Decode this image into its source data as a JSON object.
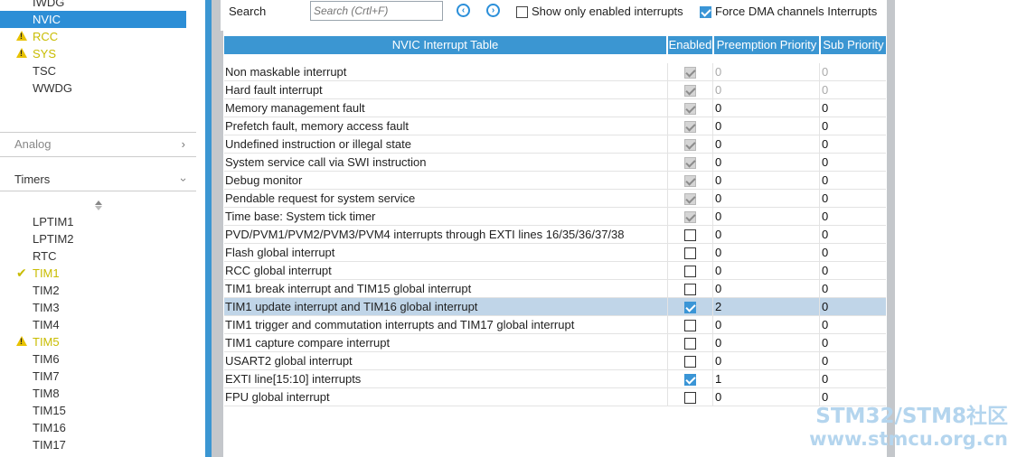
{
  "sidebar": {
    "items_top": [
      {
        "label": "IWDG",
        "state": "normal"
      },
      {
        "label": "NVIC",
        "state": "selected"
      },
      {
        "label": "RCC",
        "state": "warning"
      },
      {
        "label": "SYS",
        "state": "warning"
      },
      {
        "label": "TSC",
        "state": "normal"
      },
      {
        "label": "WWDG",
        "state": "normal"
      }
    ],
    "analog_label": "Analog",
    "timers_label": "Timers",
    "timers": [
      {
        "label": "LPTIM1",
        "state": "normal"
      },
      {
        "label": "LPTIM2",
        "state": "normal"
      },
      {
        "label": "RTC",
        "state": "normal"
      },
      {
        "label": "TIM1",
        "state": "ok"
      },
      {
        "label": "TIM2",
        "state": "normal"
      },
      {
        "label": "TIM3",
        "state": "normal"
      },
      {
        "label": "TIM4",
        "state": "normal"
      },
      {
        "label": "TIM5",
        "state": "warning"
      },
      {
        "label": "TIM6",
        "state": "normal"
      },
      {
        "label": "TIM7",
        "state": "normal"
      },
      {
        "label": "TIM8",
        "state": "normal"
      },
      {
        "label": "TIM15",
        "state": "normal"
      },
      {
        "label": "TIM16",
        "state": "normal"
      },
      {
        "label": "TIM17",
        "state": "normal"
      }
    ]
  },
  "toolbar": {
    "search_label": "Search",
    "search_placeholder": "Search (Crtl+F)",
    "show_enabled_label": "Show only enabled interrupts",
    "show_enabled_checked": false,
    "force_dma_label": "Force DMA channels Interrupts",
    "force_dma_checked": true
  },
  "table": {
    "columns": [
      "NVIC Interrupt Table",
      "Enabled",
      "Preemption Priority",
      "Sub Priority"
    ],
    "rows": [
      {
        "name": "Non maskable interrupt",
        "enabled": true,
        "locked": true,
        "preemption": "0",
        "sub": "0",
        "dim": true
      },
      {
        "name": "Hard fault interrupt",
        "enabled": true,
        "locked": true,
        "preemption": "0",
        "sub": "0",
        "dim": true
      },
      {
        "name": "Memory management fault",
        "enabled": true,
        "locked": true,
        "preemption": "0",
        "sub": "0"
      },
      {
        "name": "Prefetch fault, memory access fault",
        "enabled": true,
        "locked": true,
        "preemption": "0",
        "sub": "0"
      },
      {
        "name": "Undefined instruction or illegal state",
        "enabled": true,
        "locked": true,
        "preemption": "0",
        "sub": "0"
      },
      {
        "name": "System service call via SWI instruction",
        "enabled": true,
        "locked": true,
        "preemption": "0",
        "sub": "0"
      },
      {
        "name": "Debug monitor",
        "enabled": true,
        "locked": true,
        "preemption": "0",
        "sub": "0"
      },
      {
        "name": "Pendable request for system service",
        "enabled": true,
        "locked": true,
        "preemption": "0",
        "sub": "0"
      },
      {
        "name": "Time base: System tick timer",
        "enabled": true,
        "locked": true,
        "preemption": "0",
        "sub": "0"
      },
      {
        "name": "PVD/PVM1/PVM2/PVM3/PVM4 interrupts through EXTI lines 16/35/36/37/38",
        "enabled": false,
        "preemption": "0",
        "sub": "0"
      },
      {
        "name": "Flash global interrupt",
        "enabled": false,
        "preemption": "0",
        "sub": "0"
      },
      {
        "name": "RCC global interrupt",
        "enabled": false,
        "preemption": "0",
        "sub": "0"
      },
      {
        "name": "TIM1 break interrupt and TIM15 global interrupt",
        "enabled": false,
        "preemption": "0",
        "sub": "0"
      },
      {
        "name": "TIM1 update interrupt and TIM16 global interrupt",
        "enabled": true,
        "preemption": "2",
        "sub": "0",
        "selected": true
      },
      {
        "name": "TIM1 trigger and commutation interrupts and TIM17 global interrupt",
        "enabled": false,
        "preemption": "0",
        "sub": "0"
      },
      {
        "name": "TIM1 capture compare interrupt",
        "enabled": false,
        "preemption": "0",
        "sub": "0"
      },
      {
        "name": "USART2 global interrupt",
        "enabled": false,
        "preemption": "0",
        "sub": "0"
      },
      {
        "name": "EXTI line[15:10] interrupts",
        "enabled": true,
        "preemption": "1",
        "sub": "0"
      },
      {
        "name": "FPU global interrupt",
        "enabled": false,
        "preemption": "0",
        "sub": "0"
      }
    ]
  },
  "watermark": {
    "line1": "STM32/STM8社区",
    "line2": "www.stmcu.org.cn"
  }
}
